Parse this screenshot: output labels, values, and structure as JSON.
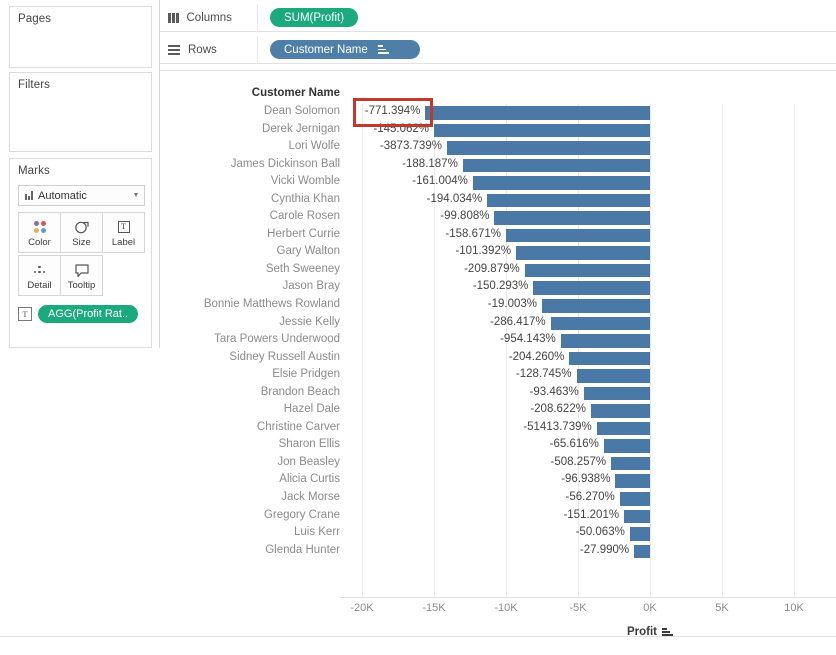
{
  "app": {
    "accent_green": "#1ba97e",
    "accent_blue": "#4e7fa8",
    "bar_color": "#4a78a7",
    "highlight_color": "#c0392b"
  },
  "left_panel": {
    "pages": {
      "title": "Pages"
    },
    "filters": {
      "title": "Filters"
    },
    "marks": {
      "title": "Marks",
      "mark_type": "Automatic",
      "mark_type_icon": "bar-chart-icon",
      "caret_icon": "chevron-down-icon",
      "buttons": [
        {
          "label": "Color",
          "icon": "color-dots-icon"
        },
        {
          "label": "Size",
          "icon": "size-circle-icon"
        },
        {
          "label": "Label",
          "icon": "label-text-icon"
        },
        {
          "label": "Detail",
          "icon": "detail-dots-icon"
        },
        {
          "label": "Tooltip",
          "icon": "tooltip-balloon-icon"
        }
      ],
      "pill": {
        "label": "AGG(Profit Rat..",
        "icon": "label-text-icon"
      }
    }
  },
  "shelves": {
    "columns": {
      "label": "Columns",
      "icon": "columns-icon",
      "pill": {
        "label": "SUM(Profit)",
        "type": "measure"
      }
    },
    "rows": {
      "label": "Rows",
      "icon": "rows-icon",
      "pill": {
        "label": "Customer Name",
        "type": "dimension",
        "sort_icon": "sort-ascending-icon"
      }
    }
  },
  "view": {
    "row_header_title": "Customer Name",
    "axis": {
      "title": "Profit",
      "sort_icon": "sort-ascending-icon",
      "ticks": [
        "-20K",
        "-15K",
        "-10K",
        "-5K",
        "0K",
        "5K",
        "10K"
      ],
      "tick_values": [
        -20000,
        -15000,
        -10000,
        -5000,
        0,
        5000,
        10000
      ]
    },
    "highlight_annotation": {
      "target_label": "-771.394%",
      "target_row": "Dean Solomon"
    }
  },
  "chart_data": {
    "type": "bar",
    "title": "",
    "xlabel": "Profit",
    "ylabel": "Customer Name",
    "orientation": "horizontal",
    "grid": true,
    "legend": "none",
    "xlim": [
      -21000,
      11500
    ],
    "xticks": [
      -20000,
      -15000,
      -10000,
      -5000,
      0,
      5000,
      10000
    ],
    "xticklabels": [
      "-20K",
      "-15K",
      "-10K",
      "-5K",
      "0K",
      "5K",
      "10K"
    ],
    "value_label_field": "AGG(Profit Ratio)",
    "categories": [
      "Dean Solomon",
      "Derek Jernigan",
      "Lori Wolfe",
      "James Dickinson Ball",
      "Vicki Womble",
      "Cynthia Khan",
      "Carole Rosen",
      "Herbert Currie",
      "Gary Walton",
      "Seth Sweeney",
      "Jason Bray",
      "Bonnie Matthews Rowland",
      "Jessie Kelly",
      "Tara Powers Underwood",
      "Sidney Russell Austin",
      "Elsie Pridgen",
      "Brandon Beach",
      "Hazel Dale",
      "Christine Carver",
      "Sharon Ellis",
      "Jon Beasley",
      "Alicia Curtis",
      "Jack Morse",
      "Gregory Crane",
      "Luis Kerr",
      "Glenda Hunter"
    ],
    "values": [
      -15600,
      -15000,
      -14100,
      -13000,
      -12300,
      -11300,
      -10800,
      -10000,
      -9300,
      -8700,
      -8100,
      -7500,
      -6900,
      -6200,
      -5600,
      -5100,
      -4600,
      -4100,
      -3700,
      -3200,
      -2700,
      -2400,
      -2100,
      -1800,
      -1400,
      -1100
    ],
    "labels": [
      "-771.394%",
      "-145.062%",
      "-3873.739%",
      "-188.187%",
      "-161.004%",
      "-194.034%",
      "-99.808%",
      "-158.671%",
      "-101.392%",
      "-209.879%",
      "-150.293%",
      "-19.003%",
      "-286.417%",
      "-954.143%",
      "-204.260%",
      "-128.745%",
      "-93.463%",
      "-208.622%",
      "-51413.739%",
      "-65.616%",
      "-508.257%",
      "-96.938%",
      "-56.270%",
      "-151.201%",
      "-50.063%",
      "-27.990%"
    ]
  }
}
